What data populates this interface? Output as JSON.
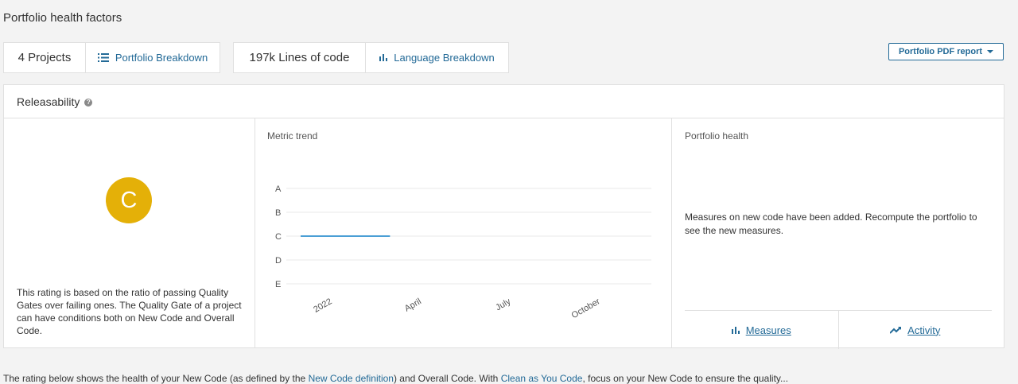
{
  "page": {
    "title": "Portfolio health factors"
  },
  "projects": {
    "count_label": "4 Projects",
    "breakdown_label": "Portfolio Breakdown"
  },
  "lines": {
    "count_label": "197k Lines of code",
    "breakdown_label": "Language Breakdown"
  },
  "pdf_report": {
    "label": "Portfolio PDF report"
  },
  "releasability": {
    "title": "Releasability",
    "rating": "C",
    "rating_color": "#e4b008",
    "description": "This rating is based on the ratio of passing Quality Gates over failing ones. The Quality Gate of a project can have conditions both on New Code and Overall Code."
  },
  "metric_trend": {
    "title": "Metric trend"
  },
  "chart_data": {
    "type": "line",
    "y_categories": [
      "A",
      "B",
      "C",
      "D",
      "E"
    ],
    "x_ticks": [
      "2022",
      "April",
      "July",
      "October"
    ],
    "series": [
      {
        "points": [
          {
            "x": "2022-01",
            "y": "C"
          },
          {
            "x": "2022-04",
            "y": "C"
          }
        ],
        "color": "#4b9fd5"
      }
    ]
  },
  "portfolio_health": {
    "title": "Portfolio health",
    "message": "Measures on new code have been added. Recompute the portfolio to see the new measures.",
    "measures_label": "Measures",
    "activity_label": "Activity"
  },
  "bottom": {
    "t1": "The rating below shows the health of your New Code (as defined by the ",
    "l1": "New Code definition",
    "t2": ") and Overall Code. With ",
    "l2": "Clean as You Code",
    "t3": ", focus on your New Code to ensure the quality..."
  },
  "colors": {
    "accent": "#236a97",
    "rating_c": "#e4b008",
    "trend_line": "#4b9fd5"
  }
}
